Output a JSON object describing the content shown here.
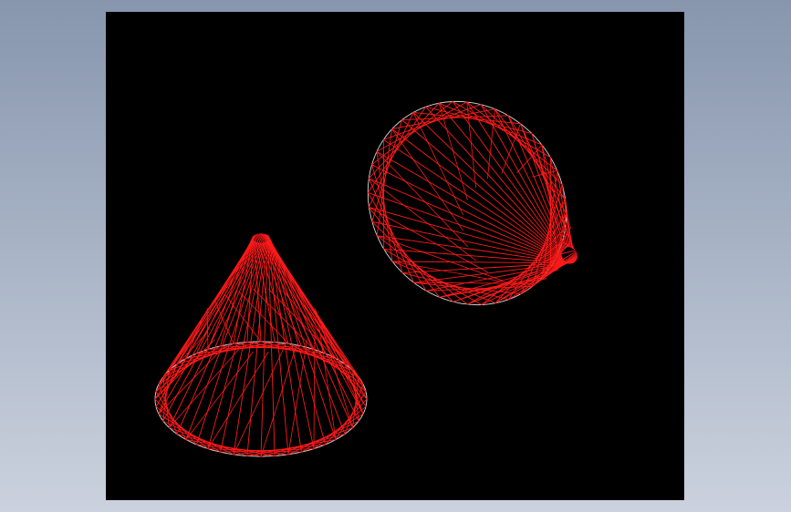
{
  "background": {
    "top_color": "#8796ae",
    "bottom_color": "#cbd2de"
  },
  "viewport": {
    "background_color": "#000000"
  },
  "models": [
    {
      "name": "cone-upright",
      "orientation": "apex-up",
      "wire_color": "#ff1a1a",
      "outline_color": "#d8d8d8",
      "ruling_count": 48,
      "twist_steps": 7
    },
    {
      "name": "cone-tilted",
      "orientation": "tilted",
      "wire_color": "#ff1a1a",
      "outline_color": "#d8d8d8",
      "ruling_count": 44,
      "twist_steps": 8
    }
  ]
}
